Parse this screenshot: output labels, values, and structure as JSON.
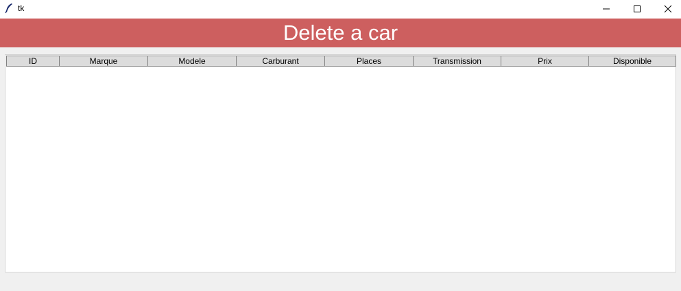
{
  "window": {
    "title": "tk",
    "icon": "feather-icon",
    "controls": [
      "minimize-icon",
      "maximize-icon",
      "close-icon"
    ]
  },
  "header": {
    "title": "Delete a car",
    "background_color": "#cd5f5f",
    "text_color": "#ffffff"
  },
  "table": {
    "columns": [
      "ID",
      "Marque",
      "Modele",
      "Carburant",
      "Places",
      "Transmission",
      "Prix",
      "Disponible"
    ],
    "rows": []
  }
}
